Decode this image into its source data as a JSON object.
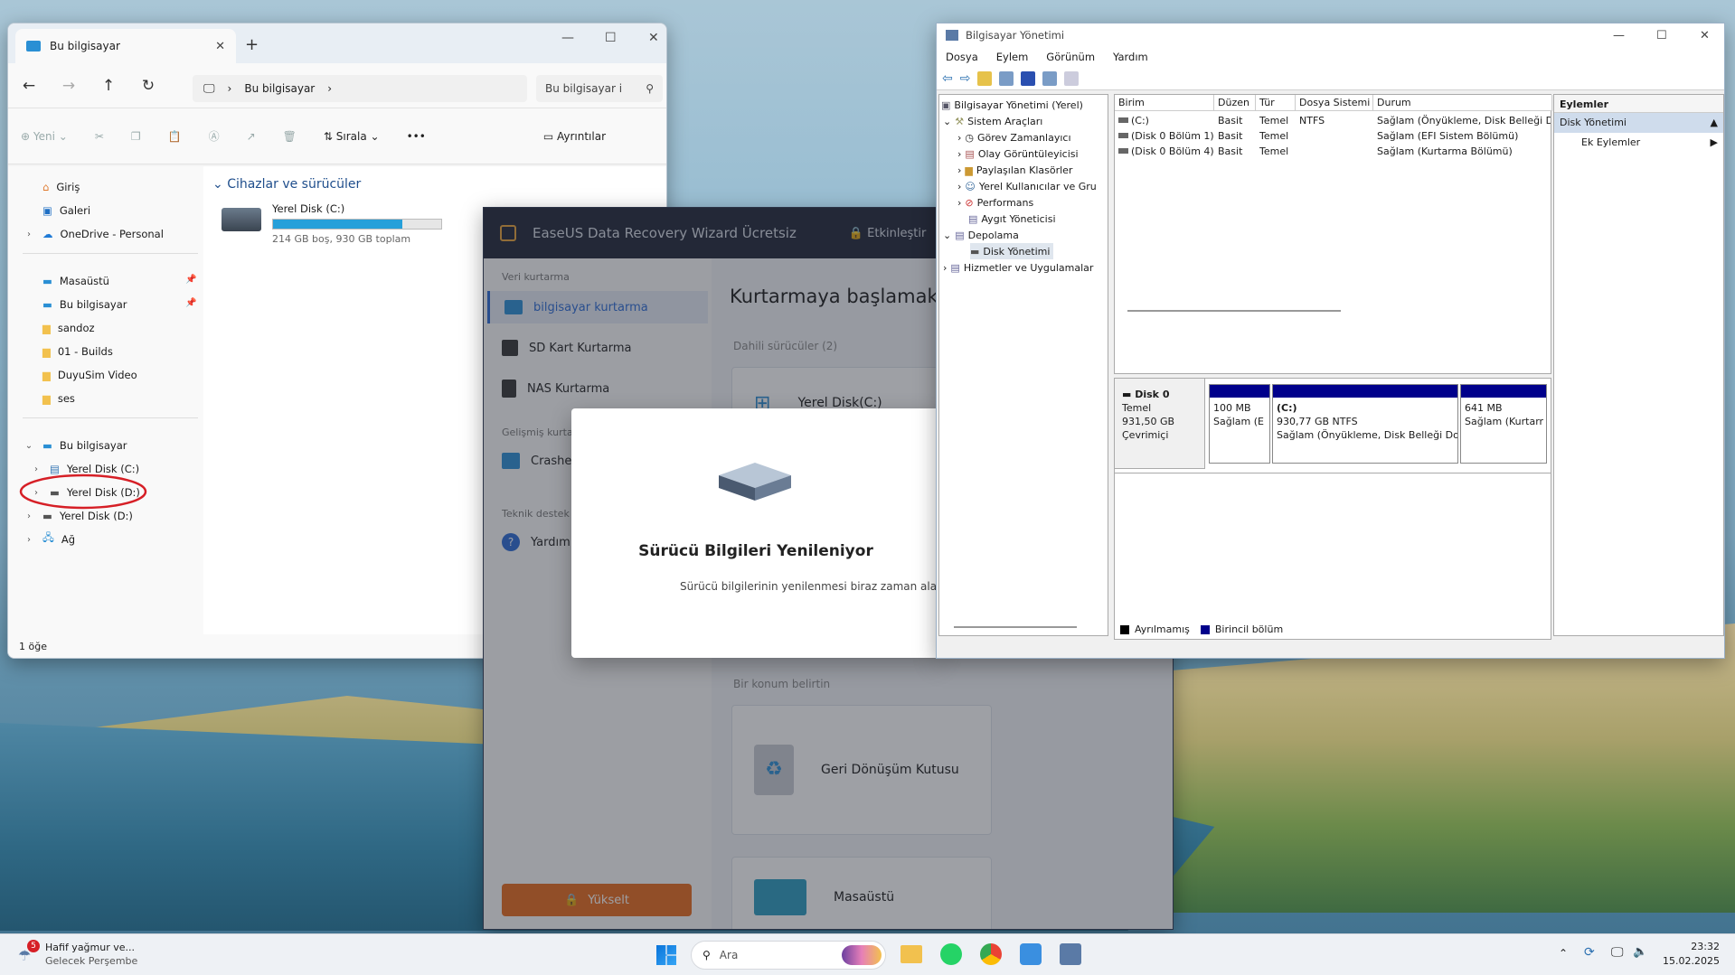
{
  "explorer": {
    "tab_title": "Bu bilgisayar",
    "address_crumb": "Bu bilgisayar",
    "search_placeholder": "Bu bilgisayar i",
    "cmd": {
      "new": "Yeni",
      "sort": "Sırala",
      "details": "Ayrıntılar"
    },
    "sidebar": {
      "home": "Giriş",
      "gallery": "Galeri",
      "onedrive": "OneDrive - Personal",
      "desktop": "Masaüstü",
      "thispc_pin": "Bu bilgisayar",
      "sandoz": "sandoz",
      "builds": "01 - Builds",
      "duyusim": "DuyuSim Video",
      "ses": "ses",
      "thispc": "Bu bilgisayar",
      "disk_c": "Yerel Disk (C:)",
      "disk_d1": "Yerel Disk (D:)",
      "disk_d2": "Yerel Disk (D:)",
      "network": "Ağ"
    },
    "section": "Cihazlar ve sürücüler",
    "drive": {
      "name": "Yerel Disk (C:)",
      "free": "214 GB boş, 930 GB toplam",
      "used_fraction": 0.77
    },
    "status": "1 öğe"
  },
  "easeus": {
    "title": "EaseUS Data Recovery Wizard Ücretsiz",
    "activate": "Etkinleştir",
    "side": {
      "group1": "Veri kurtarma",
      "pc_recovery": "bilgisayar kurtarma",
      "sd": "SD Kart Kurtarma",
      "nas": "NAS Kurtarma",
      "group2": "Gelişmiş kurta",
      "crash": "Crashe",
      "group3": "Teknik destek",
      "help": "Yardım",
      "upgrade": "Yükselt"
    },
    "main": {
      "heading": "Kurtarmaya başlamak iç",
      "internal": "Dahili sürücüler (2)",
      "local_disk": "Yerel Disk(C:)",
      "location": "Bir konum belirtin",
      "recycle": "Geri Dönüşüm Kutusu",
      "desktop": "Masaüstü"
    },
    "dialog": {
      "title": "Sürücü Bilgileri Yenileniyor",
      "text": "Sürücü bilgilerinin yenilenmesi biraz zaman ala"
    }
  },
  "cm": {
    "title": "Bilgisayar Yönetimi",
    "menu": [
      "Dosya",
      "Eylem",
      "Görünüm",
      "Yardım"
    ],
    "tree": {
      "root": "Bilgisayar Yönetimi (Yerel)",
      "sys": "Sistem Araçları",
      "task": "Görev Zamanlayıcı",
      "event": "Olay Görüntüleyicisi",
      "shared": "Paylaşılan Klasörler",
      "users": "Yerel Kullanıcılar ve Gru",
      "perf": "Performans",
      "devmgr": "Aygıt Yöneticisi",
      "storage": "Depolama",
      "diskmgmt": "Disk Yönetimi",
      "services": "Hizmetler ve Uygulamalar"
    },
    "columns": [
      "Birim",
      "Düzen",
      "Tür",
      "Dosya Sistemi",
      "Durum"
    ],
    "rows": [
      [
        "(C:)",
        "Basit",
        "Temel",
        "NTFS",
        "Sağlam (Önyükleme, Disk Belleği Do"
      ],
      [
        "(Disk 0 Bölüm 1)",
        "Basit",
        "Temel",
        "",
        "Sağlam (EFI Sistem Bölümü)"
      ],
      [
        "(Disk 0 Bölüm 4)",
        "Basit",
        "Temel",
        "",
        "Sağlam (Kurtarma Bölümü)"
      ]
    ],
    "disk": {
      "name": "Disk 0",
      "type": "Temel",
      "size": "931,50 GB",
      "state": "Çevrimiçi",
      "p1_size": "100 MB",
      "p1_status": "Sağlam (E",
      "p2_name": "(C:)",
      "p2_size": "930,77 GB NTFS",
      "p2_status": "Sağlam (Önyükleme, Disk Belleği Do",
      "p3_size": "641 MB",
      "p3_status": "Sağlam (Kurtarr"
    },
    "legend": {
      "unalloc": "Ayrılmamış",
      "primary": "Birincil bölüm"
    },
    "actions": {
      "header": "Eylemler",
      "section": "Disk Yönetimi",
      "more": "Ek Eylemler"
    }
  },
  "taskbar": {
    "weather_badge": "5",
    "weather_title": "Hafif yağmur ve...",
    "weather_sub": "Gelecek Perşembe",
    "search": "Ara",
    "time": "23:32",
    "date": "15.02.2025"
  },
  "colors": {
    "accent": "#26a0da",
    "easeus_header": "#1f2638",
    "easeus_upgrade": "#e86a1c",
    "partition_blue": "#00008b",
    "annotation": "#d61f26"
  }
}
